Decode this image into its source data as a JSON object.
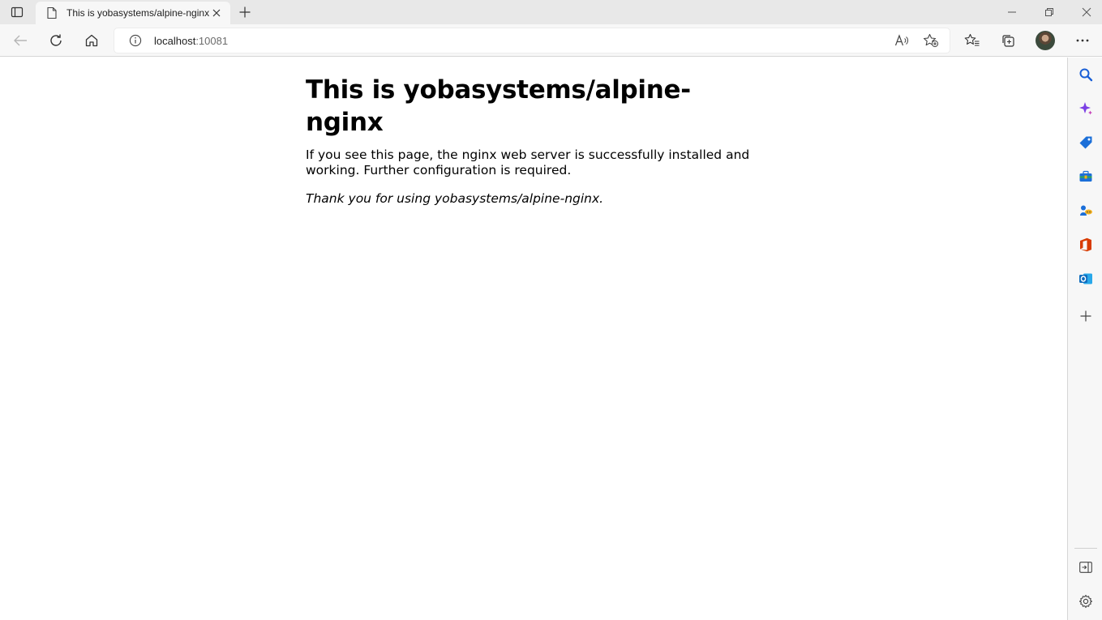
{
  "browser": {
    "tab": {
      "title": "This is yobasystems/alpine-nginx",
      "favicon": "page-icon"
    },
    "address_bar": {
      "url_host": "localhost",
      "url_port": ":10081"
    },
    "toolbar_icons": [
      "back-icon",
      "refresh-icon",
      "home-icon",
      "read-aloud-icon",
      "add-favorite-icon",
      "favorites-icon",
      "collections-icon",
      "profile-avatar",
      "more-icon"
    ],
    "sidebar_icons": [
      "search-icon",
      "copilot-icon",
      "shopping-icon",
      "tools-icon",
      "games-icon",
      "office-icon",
      "outlook-icon",
      "add-icon",
      "hide-sidebar-icon",
      "settings-icon"
    ]
  },
  "page": {
    "heading": "This is yobasystems/alpine-nginx",
    "paragraph": "If you see this page, the nginx web server is successfully installed and working. Further configuration is required.",
    "thanks": "Thank you for using yobasystems/alpine-nginx."
  },
  "colors": {
    "chrome_bg": "#f7f7f7",
    "titlebar_bg": "#e8e8e8",
    "sidebar_search": "#1a5fd6",
    "copilot": "#7b3fe4",
    "shopping": "#1b6fd8",
    "office": "#d83b01",
    "outlook": "#0f6cbd"
  }
}
